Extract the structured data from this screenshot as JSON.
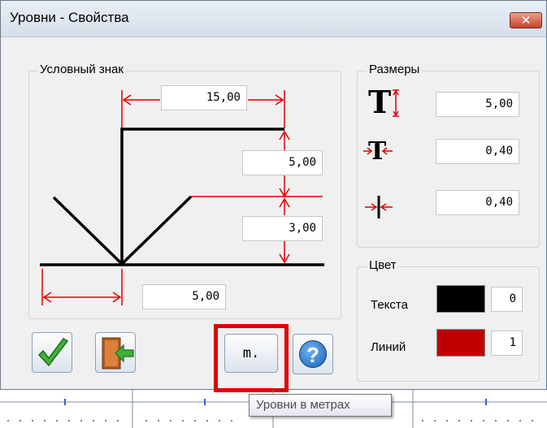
{
  "window": {
    "title": "Уровни - Свойства",
    "close_glyph": "✕"
  },
  "symbol_group": {
    "label": "Условный знак",
    "width_value": "15,00",
    "height_value": "5,00",
    "offset_value": "3,00",
    "base_value": "5,00"
  },
  "sizes_group": {
    "label": "Размеры",
    "text_height": "5,00",
    "text_width": "0,40",
    "line_width": "0,40"
  },
  "color_group": {
    "label": "Цвет",
    "text_label": "Текста",
    "text_color": "#000000",
    "text_index": "0",
    "line_label": "Линий",
    "line_color": "#c00000",
    "line_index": "1"
  },
  "buttons": {
    "ok_icon": "check-icon",
    "exit_icon": "exit-door-icon",
    "meters_label": "m.",
    "help_label": "?"
  },
  "tooltip": {
    "text": "Уровни в метрах"
  },
  "colors": {
    "highlight": "#e00000",
    "dimension_red": "#e00000"
  }
}
